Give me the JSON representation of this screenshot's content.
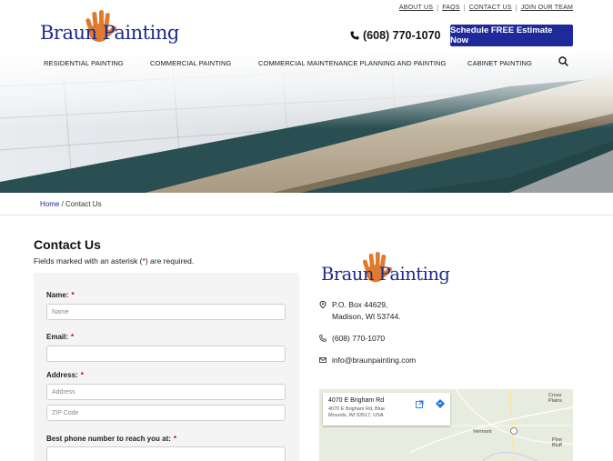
{
  "utility": {
    "about": "ABOUT US",
    "faqs": "FAQS",
    "contact": "CONTACT US",
    "join": "JOIN OUR TEAM"
  },
  "logo": {
    "text": "Braun Painting"
  },
  "header": {
    "phone": "(608) 770-1070",
    "cta": "Schedule FREE Estimate Now"
  },
  "nav": {
    "residential": "RESIDENTIAL PAINTING",
    "commercial": "COMMERCIAL PAINTING",
    "maintenance": "COMMERCIAL MAINTENANCE PLANNING AND PAINTING",
    "cabinet": "CABINET PAINTING"
  },
  "breadcrumb": {
    "home": "Home",
    "sep": " / ",
    "current": "Contact Us"
  },
  "page": {
    "title": "Contact Us",
    "note_before": "Fields marked with an asterisk (",
    "note_ast": "*",
    "note_after": ") are required."
  },
  "form": {
    "name_label": "Name:",
    "name_placeholder": "Name",
    "email_label": "Email:",
    "address_label": "Address:",
    "address_placeholder": "Address",
    "zip_placeholder": "ZIP Code",
    "phone_label": "Best phone number to reach you at:",
    "required_mark": "*"
  },
  "contact": {
    "address_line1": "P.O. Box 44629,",
    "address_line2": "Madison, WI 53744.",
    "phone": "(608) 770-1070",
    "email": "info@braunpainting.com"
  },
  "map": {
    "place_name": "4070 E Brigham Rd",
    "place_address": "4070 E Brigham Rd, Blue Mounds, WI 53517, USA",
    "labels": [
      "Cross Plains",
      "Vermont",
      "Pine Bluff"
    ]
  },
  "colors": {
    "brand_blue": "#1e2a9a",
    "logo_orange": "#e07a2e",
    "required_red": "#cc0000"
  }
}
